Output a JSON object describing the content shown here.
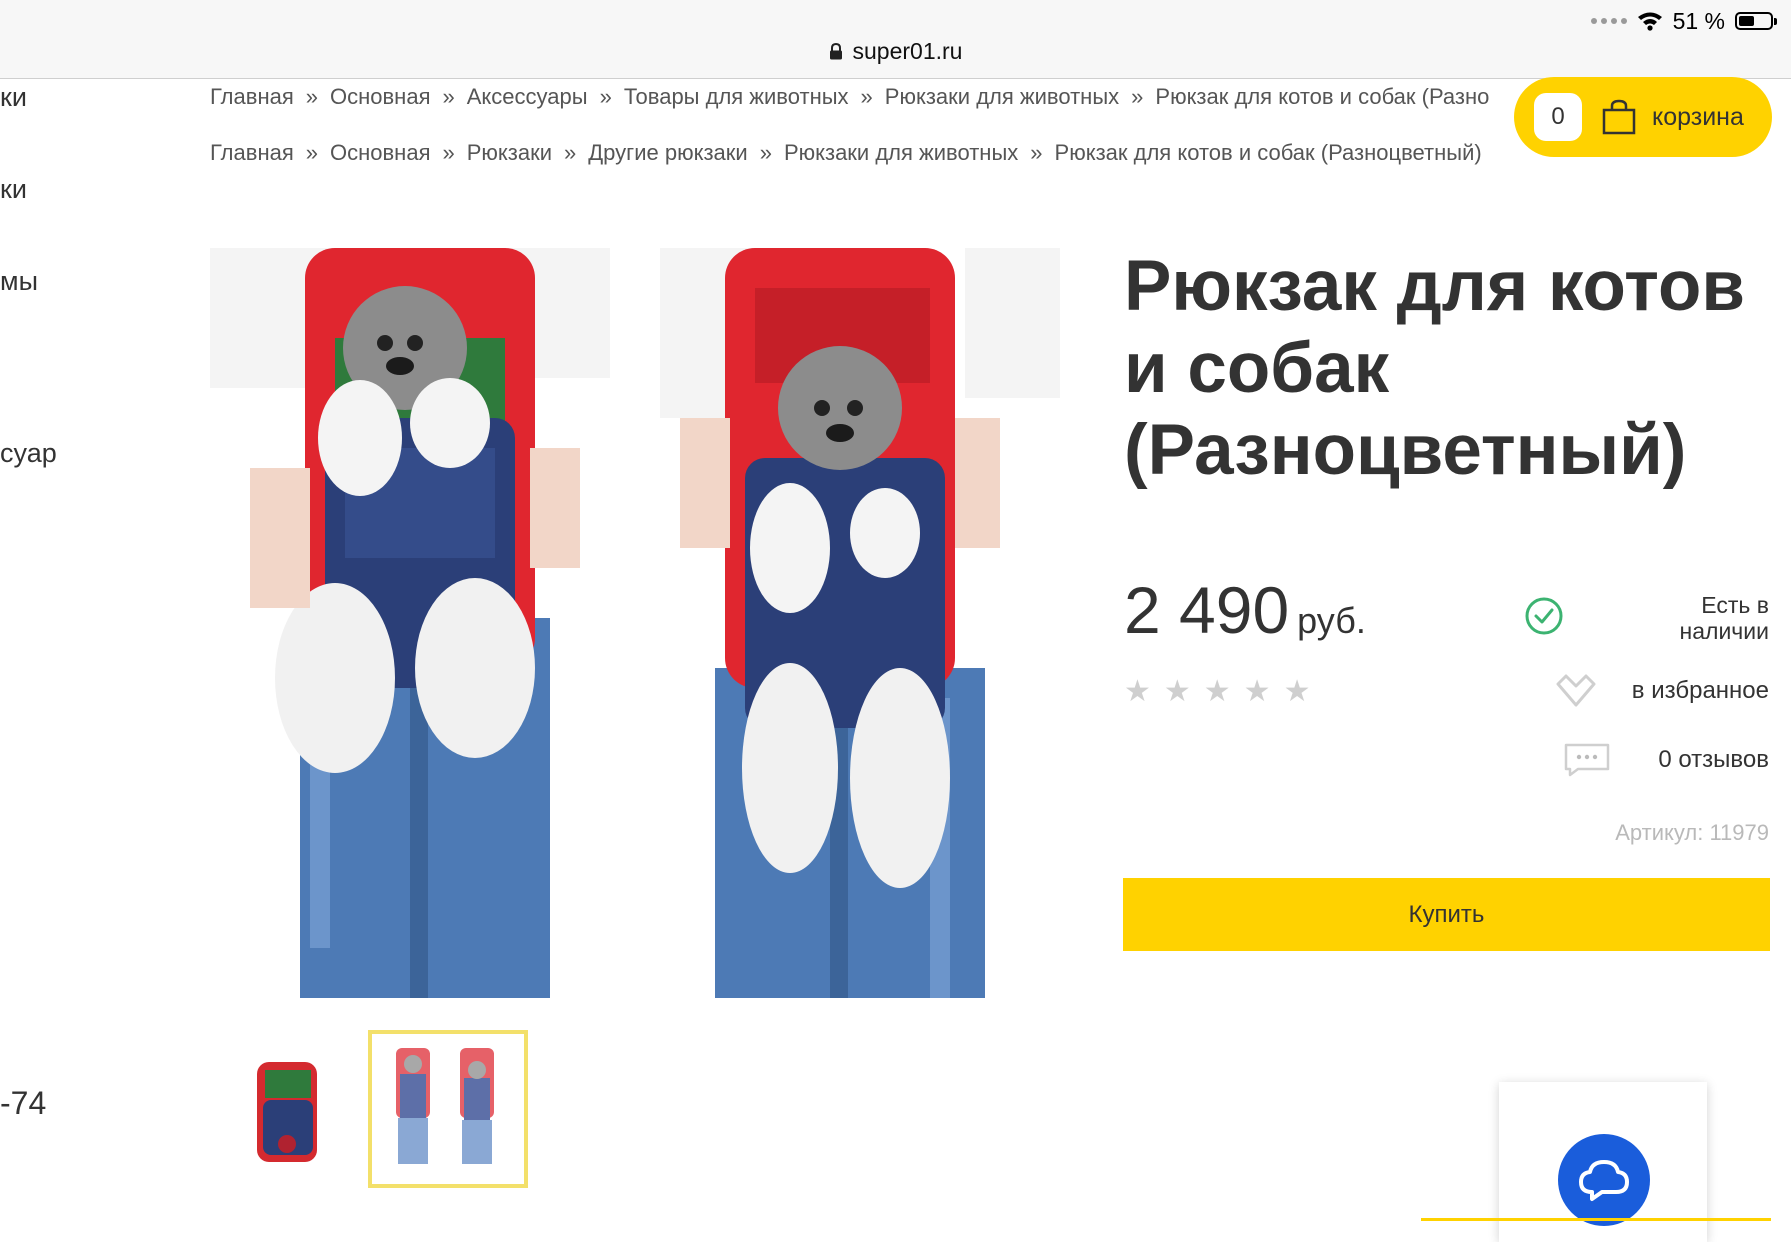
{
  "status_bar": {
    "battery_text": "51 %",
    "battery_level": 0.51
  },
  "browser": {
    "url": "super01.ru"
  },
  "left_menu": {
    "items": [
      "ки",
      "ки",
      "мы",
      "суар",
      "-74"
    ]
  },
  "breadcrumbs": [
    [
      "Главная",
      "Основная",
      "Аксессуары",
      "Товары для животных",
      "Рюкзаки для животных",
      "Рюкзак для котов и собак (Разно"
    ],
    [
      "Главная",
      "Основная",
      "Рюкзаки",
      "Другие рюкзаки",
      "Рюкзаки для животных",
      "Рюкзак для котов и собак (Разноцветный)"
    ]
  ],
  "breadcrumb_separator": "»",
  "cart": {
    "count": "0",
    "label": "корзина"
  },
  "product": {
    "title": "Рюкзак для котов и собак (Разноцветный)",
    "price": "2 490",
    "currency": "руб.",
    "rating": 0,
    "stars": "★★★★★",
    "availability": "Есть в наличии",
    "favorite_label": "в избранное",
    "reviews_label": "0 отзывов",
    "sku_label": "Артикул: 11979",
    "buy_label": "Купить"
  },
  "colors": {
    "accent": "#ffd200",
    "success": "#3cb371",
    "chat": "#1a5ddb"
  }
}
